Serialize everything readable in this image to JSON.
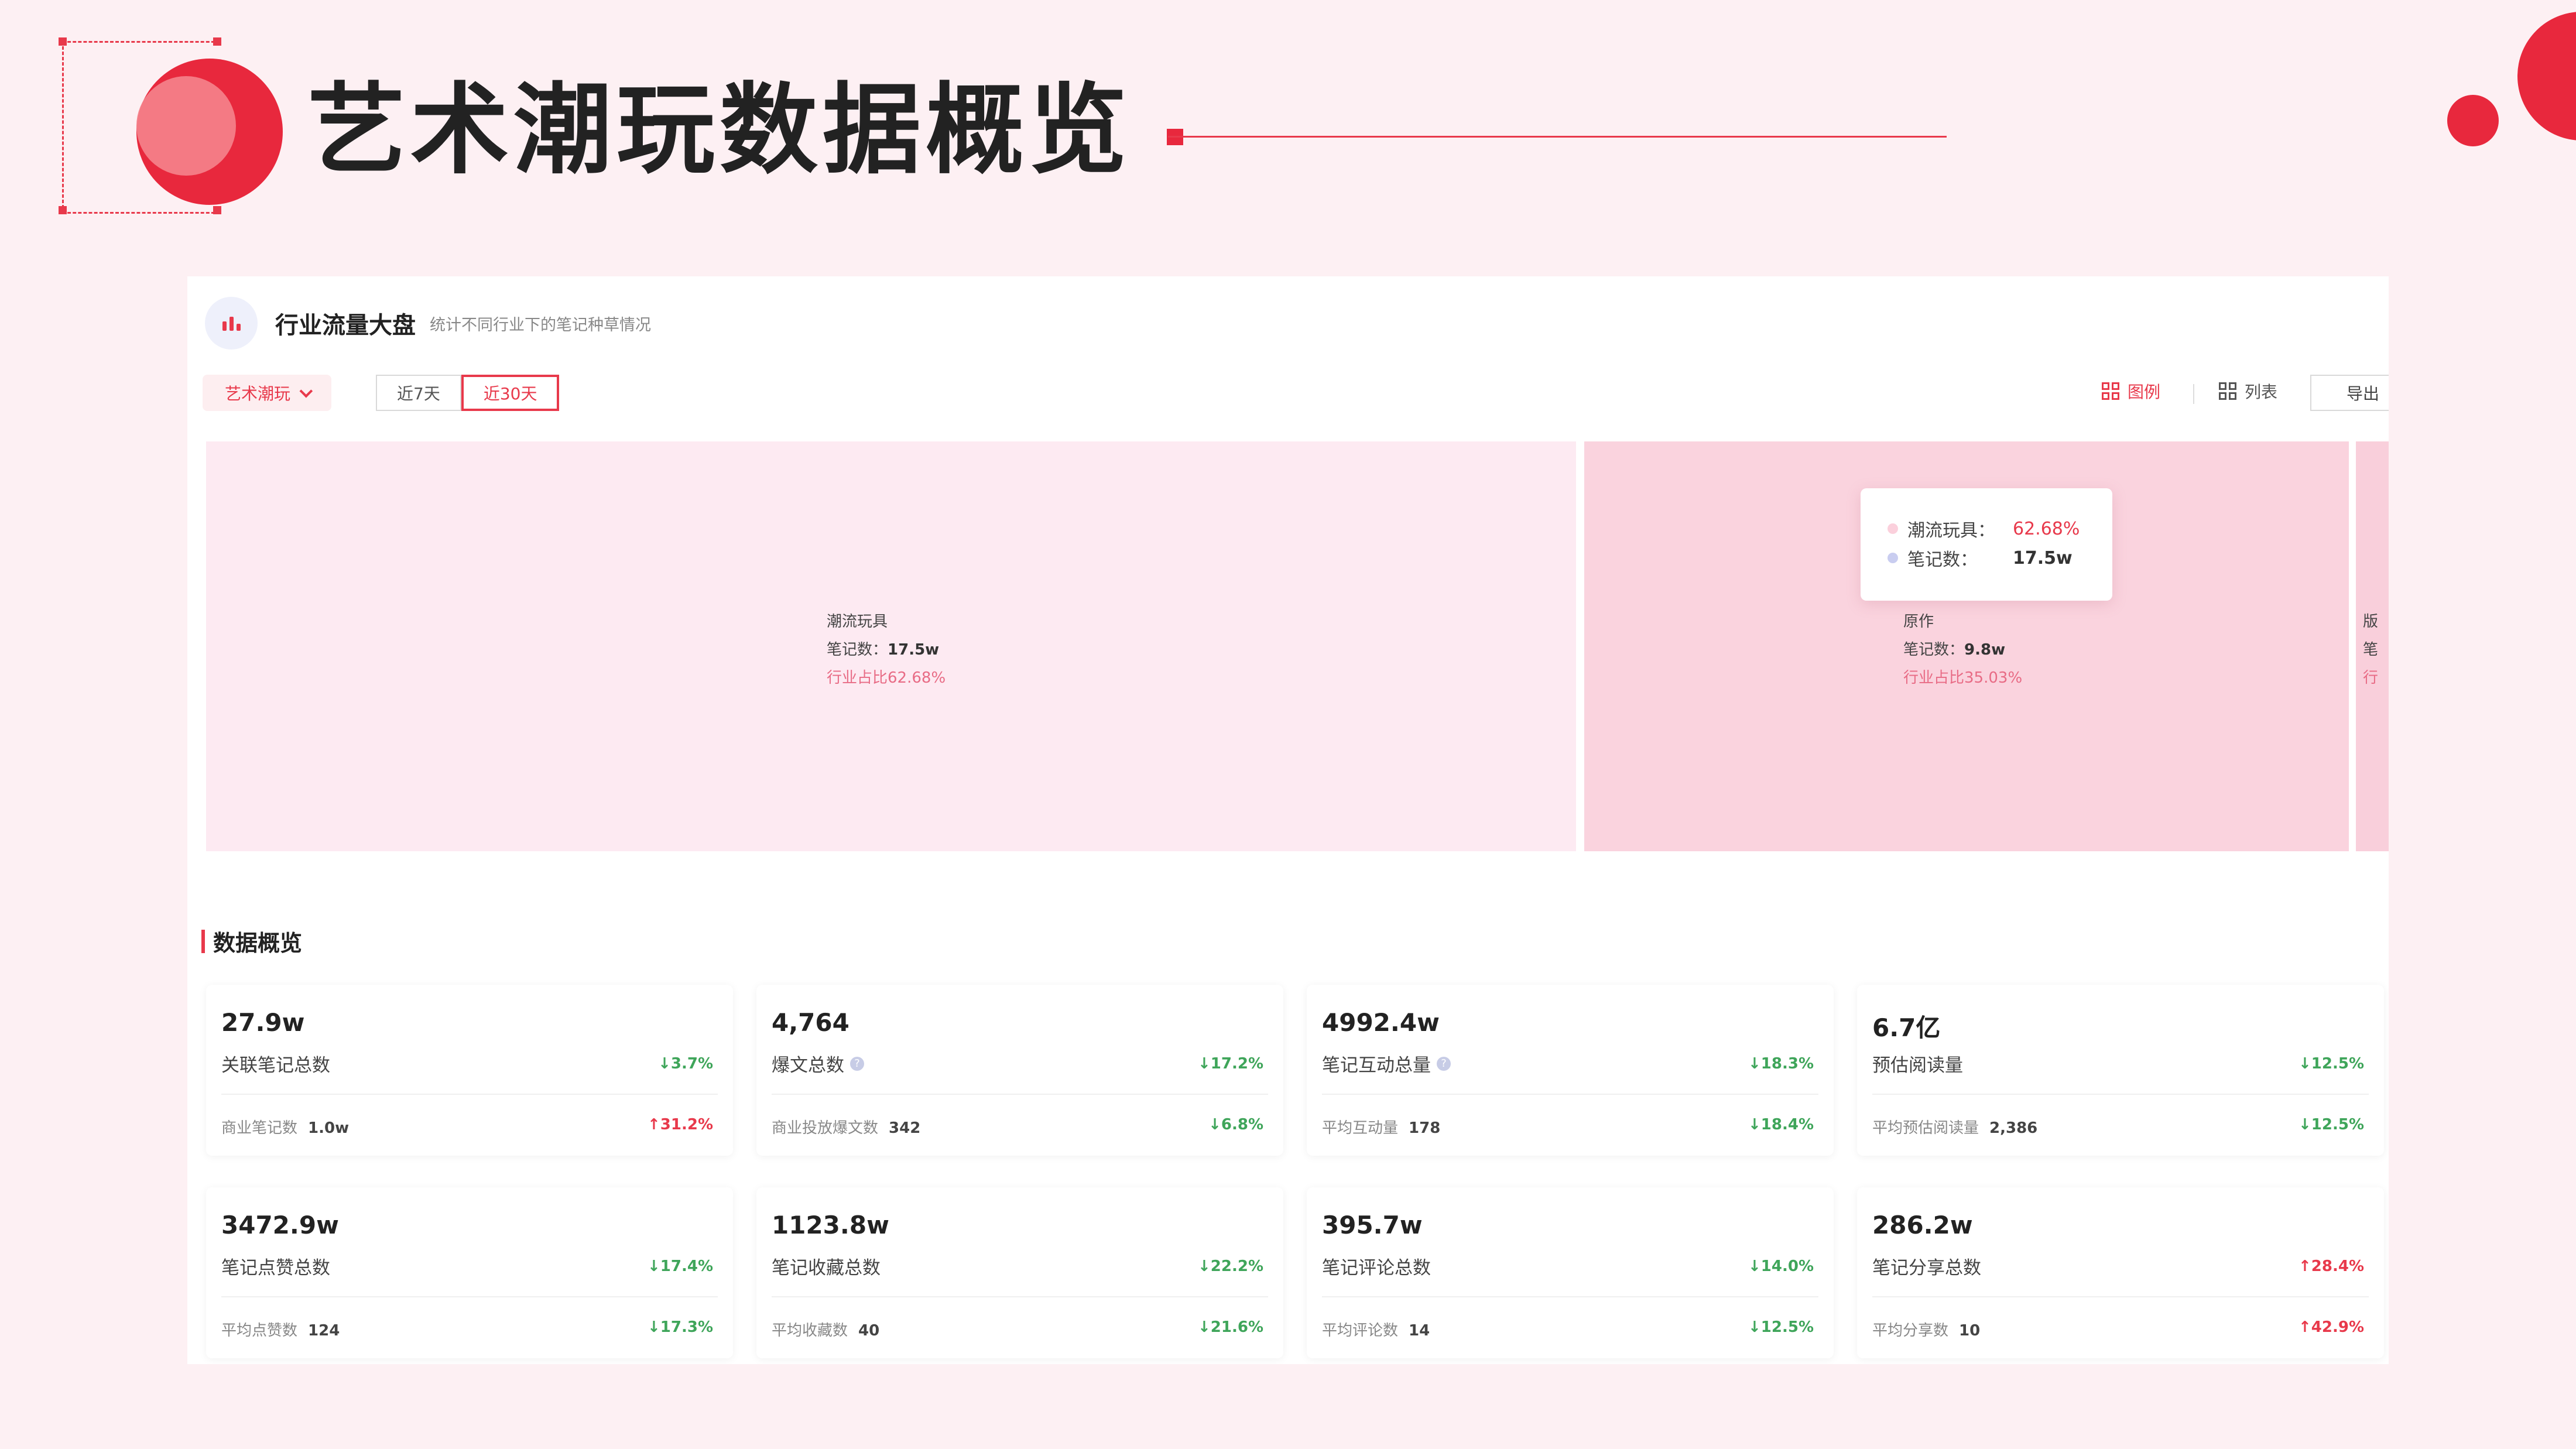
{
  "slide": {
    "title": "艺术潮玩数据概览",
    "accent_color": "#e8283d"
  },
  "panel": {
    "title": "行业流量大盘",
    "subtitle": "统计不同行业下的笔记种草情况",
    "category": "艺术潮玩",
    "ranges": [
      "近7天",
      "近30天"
    ],
    "active_range": "近30天",
    "view_chart_label": "图例",
    "view_list_label": "列表",
    "export_label": "导出"
  },
  "treemap": {
    "tiles": [
      {
        "name": "潮流玩具",
        "notes_label": "笔记数：",
        "notes": "17.5w",
        "share_label": "行业占比",
        "share": "62.68%"
      },
      {
        "name": "原作",
        "notes_label": "笔记数：",
        "notes": "9.8w",
        "share_label": "行业占比",
        "share": "35.03%"
      },
      {
        "name": "版",
        "notes_label": "笔",
        "notes": "",
        "share_label": "行",
        "share": ""
      }
    ],
    "tooltip": {
      "name_key": "潮流玩具：",
      "name_value": "62.68%",
      "notes_key": "笔记数：",
      "notes_value": "17.5w"
    }
  },
  "overview": {
    "title": "数据概览",
    "cards": [
      {
        "value": "27.9w",
        "label": "关联笔记总数",
        "info": false,
        "change": "3.7%",
        "dir": "down",
        "sub_label": "商业笔记数",
        "sub_value": "1.0w",
        "sub_change": "31.2%",
        "sub_dir": "up"
      },
      {
        "value": "4,764",
        "label": "爆文总数",
        "info": true,
        "change": "17.2%",
        "dir": "down",
        "sub_label": "商业投放爆文数",
        "sub_value": "342",
        "sub_change": "6.8%",
        "sub_dir": "down"
      },
      {
        "value": "4992.4w",
        "label": "笔记互动总量",
        "info": true,
        "change": "18.3%",
        "dir": "down",
        "sub_label": "平均互动量",
        "sub_value": "178",
        "sub_change": "18.4%",
        "sub_dir": "down"
      },
      {
        "value": "6.7亿",
        "label": "预估阅读量",
        "info": false,
        "change": "12.5%",
        "dir": "down",
        "sub_label": "平均预估阅读量",
        "sub_value": "2,386",
        "sub_change": "12.5%",
        "sub_dir": "down"
      },
      {
        "value": "3472.9w",
        "label": "笔记点赞总数",
        "info": false,
        "change": "17.4%",
        "dir": "down",
        "sub_label": "平均点赞数",
        "sub_value": "124",
        "sub_change": "17.3%",
        "sub_dir": "down"
      },
      {
        "value": "1123.8w",
        "label": "笔记收藏总数",
        "info": false,
        "change": "22.2%",
        "dir": "down",
        "sub_label": "平均收藏数",
        "sub_value": "40",
        "sub_change": "21.6%",
        "sub_dir": "down"
      },
      {
        "value": "395.7w",
        "label": "笔记评论总数",
        "info": false,
        "change": "14.0%",
        "dir": "down",
        "sub_label": "平均评论数",
        "sub_value": "14",
        "sub_change": "12.5%",
        "sub_dir": "down"
      },
      {
        "value": "286.2w",
        "label": "笔记分享总数",
        "info": false,
        "change": "28.4%",
        "dir": "up",
        "sub_label": "平均分享数",
        "sub_value": "10",
        "sub_change": "42.9%",
        "sub_dir": "up"
      }
    ]
  }
}
